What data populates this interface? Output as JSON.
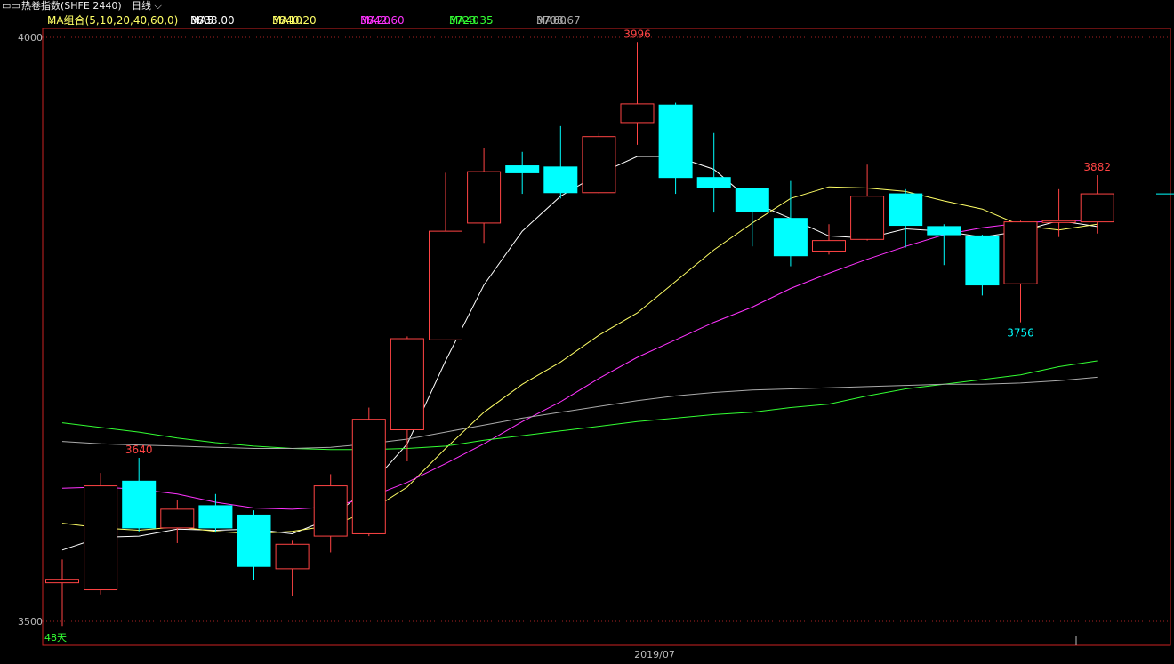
{
  "window": {
    "title": "热卷指数(SHFE 2440)",
    "period": "日线"
  },
  "legend": {
    "group_label": "MA组合(5,10,20,40,60,0)",
    "items": [
      {
        "label": "MA5",
        "value": "3838.00",
        "color": "#ffffff"
      },
      {
        "label": "MA10",
        "value": "3840.20",
        "color": "#ffff66"
      },
      {
        "label": "MA20",
        "value": "3842.60",
        "color": "#ff33ff"
      },
      {
        "label": "MA40",
        "value": "3723.35",
        "color": "#33ff33"
      },
      {
        "label": "MA60",
        "value": "3708.67",
        "color": "#aaaaaa"
      }
    ]
  },
  "colors": {
    "up": "#ff4444",
    "down": "#00ffff",
    "axis": "#cc2222",
    "grid": "#aa2222",
    "label_text": "#bbbbbb"
  },
  "chart_data": {
    "type": "candlestick",
    "ylim": [
      3500,
      4000
    ],
    "yticks": [
      "4000",
      "3500"
    ],
    "x_label": "2019/07",
    "corner_label": "48天",
    "candles": [
      {
        "open": 3533,
        "close": 3536,
        "high": 3553,
        "low": 3496
      },
      {
        "open": 3527,
        "close": 3616,
        "high": 3627,
        "low": 3523
      },
      {
        "open": 3620,
        "close": 3580,
        "high": 3640,
        "low": 3577
      },
      {
        "open": 3580,
        "close": 3596,
        "high": 3604,
        "low": 3567
      },
      {
        "open": 3599,
        "close": 3580,
        "high": 3609,
        "low": 3576
      },
      {
        "open": 3591,
        "close": 3547,
        "high": 3595,
        "low": 3535
      },
      {
        "open": 3545,
        "close": 3566,
        "high": 3569,
        "low": 3522
      },
      {
        "open": 3573,
        "close": 3616,
        "high": 3626,
        "low": 3559
      },
      {
        "open": 3575,
        "close": 3673,
        "high": 3683,
        "low": 3573
      },
      {
        "open": 3664,
        "close": 3742,
        "high": 3744,
        "low": 3637
      },
      {
        "open": 3741,
        "close": 3834,
        "high": 3884,
        "low": 3820
      },
      {
        "open": 3841,
        "close": 3885,
        "high": 3905,
        "low": 3824
      },
      {
        "open": 3890,
        "close": 3884,
        "high": 3902,
        "low": 3866
      },
      {
        "open": 3889,
        "close": 3867,
        "high": 3924,
        "low": 3862
      },
      {
        "open": 3867,
        "close": 3915,
        "high": 3918,
        "low": 3866
      },
      {
        "open": 3927,
        "close": 3943,
        "high": 3996,
        "low": 3908
      },
      {
        "open": 3942,
        "close": 3880,
        "high": 3944,
        "low": 3866
      },
      {
        "open": 3880,
        "close": 3871,
        "high": 3918,
        "low": 3850
      },
      {
        "open": 3871,
        "close": 3851,
        "high": 3871,
        "low": 3821
      },
      {
        "open": 3845,
        "close": 3813,
        "high": 3877,
        "low": 3804
      },
      {
        "open": 3817,
        "close": 3826,
        "high": 3840,
        "low": 3814
      },
      {
        "open": 3827,
        "close": 3864,
        "high": 3891,
        "low": 3826
      },
      {
        "open": 3866,
        "close": 3839,
        "high": 3870,
        "low": 3820
      },
      {
        "open": 3838,
        "close": 3831,
        "high": 3840,
        "low": 3805
      },
      {
        "open": 3830,
        "close": 3788,
        "high": 3831,
        "low": 3779
      },
      {
        "open": 3789,
        "close": 3842,
        "high": 3843,
        "low": 3756
      },
      {
        "open": 3842,
        "close": 3843,
        "high": 3870,
        "low": 3829
      },
      {
        "open": 3842,
        "close": 3866,
        "high": 3882,
        "low": 3832
      }
    ],
    "annotations": [
      {
        "candle": 15,
        "text": "3996",
        "kind": "high"
      },
      {
        "candle": 2,
        "text": "3640",
        "kind": "high"
      },
      {
        "candle": 27,
        "text": "3882",
        "kind": "high"
      },
      {
        "candle": 25,
        "text": "3756",
        "kind": "low"
      }
    ],
    "series": [
      {
        "name": "MA5",
        "color": "#ffffff",
        "values": [
          3561,
          3572,
          3573,
          3579,
          3578,
          3579,
          3575,
          3588,
          3615,
          3652,
          3723,
          3788,
          3834,
          3864,
          3883,
          3898,
          3898,
          3887,
          3859,
          3845,
          3830,
          3828,
          3836,
          3834,
          3829,
          3834,
          3843,
          3838
        ]
      },
      {
        "name": "MA10",
        "color": "#ffff66",
        "values": [
          3584,
          3580,
          3578,
          3581,
          3577,
          3575,
          3577,
          3582,
          3594,
          3615,
          3648,
          3679,
          3703,
          3722,
          3745,
          3764,
          3791,
          3818,
          3841,
          3862,
          3872,
          3871,
          3868,
          3860,
          3853,
          3839,
          3835,
          3840
        ]
      },
      {
        "name": "MA20",
        "color": "#ff33ff",
        "values": [
          3614,
          3615,
          3613,
          3609,
          3602,
          3597,
          3596,
          3598,
          3606,
          3619,
          3635,
          3652,
          3671,
          3688,
          3708,
          3726,
          3741,
          3756,
          3769,
          3785,
          3798,
          3810,
          3821,
          3831,
          3837,
          3841,
          3843,
          3843
        ]
      },
      {
        "name": "MA40",
        "color": "#33ff33",
        "values": [
          3670,
          3666,
          3662,
          3657,
          3653,
          3650,
          3648,
          3647,
          3647,
          3648,
          3650,
          3655,
          3659,
          3663,
          3667,
          3671,
          3674,
          3677,
          3679,
          3683,
          3686,
          3693,
          3699,
          3703,
          3707,
          3711,
          3718,
          3723
        ]
      },
      {
        "name": "MA60",
        "color": "#aaaaaa",
        "values": [
          3654,
          3652,
          3651,
          3650,
          3649,
          3648,
          3648,
          3649,
          3652,
          3656,
          3662,
          3668,
          3674,
          3679,
          3684,
          3689,
          3693,
          3696,
          3698,
          3699,
          3700,
          3701,
          3702,
          3703,
          3703,
          3704,
          3706,
          3709
        ]
      }
    ]
  }
}
